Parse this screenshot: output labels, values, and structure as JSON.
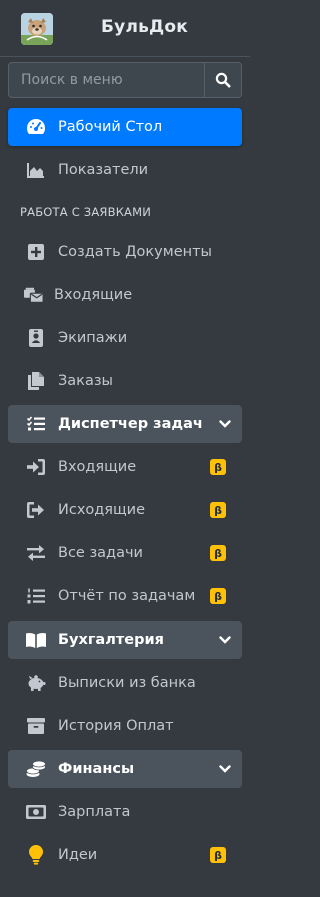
{
  "brand": {
    "title": "БульДок"
  },
  "search": {
    "placeholder": "Поиск в меню"
  },
  "colors": {
    "active": "#007bff",
    "badge": "#ffc107",
    "background": "#343a40",
    "open_group": "#4b545c"
  },
  "menu": {
    "dashboard": {
      "label": "Рабочий Стол",
      "icon": "tachometer-icon",
      "active": true
    },
    "indicators": {
      "label": "Показатели",
      "icon": "area-chart-icon"
    },
    "section_header": "РАБОТА С ЗАЯВКАМИ",
    "create_docs": {
      "label": "Создать Документы",
      "icon": "plus-square-icon"
    },
    "incoming": {
      "label": "Входящие",
      "icon": "mail-bulk-icon"
    },
    "crews": {
      "label": "Экипажи",
      "icon": "id-badge-icon"
    },
    "orders": {
      "label": "Заказы",
      "icon": "copy-icon"
    },
    "dispatcher": {
      "label": "Диспетчер задач",
      "icon": "tasks-icon",
      "expanded": true,
      "items": [
        {
          "label": "Входящие",
          "badge": "β",
          "icon": "sign-in-icon"
        },
        {
          "label": "Исходящие",
          "badge": "β",
          "icon": "sign-out-icon"
        },
        {
          "label": "Все задачи",
          "badge": "β",
          "icon": "exchange-icon"
        },
        {
          "label": "Отчёт по задачам",
          "badge": "β",
          "icon": "list-ol-icon"
        }
      ]
    },
    "accounting": {
      "label": "Бухгалтерия",
      "icon": "book-open-icon",
      "expanded": true,
      "items": [
        {
          "label": "Выписки из банка",
          "icon": "piggy-bank-icon"
        },
        {
          "label": "История Оплат",
          "icon": "archive-icon"
        }
      ]
    },
    "finance": {
      "label": "Финансы",
      "icon": "coins-icon",
      "expanded": true,
      "items": [
        {
          "label": "Зарплата",
          "icon": "money-bill-icon"
        },
        {
          "label": "Идеи",
          "badge": "β",
          "icon": "lightbulb-icon"
        }
      ]
    }
  }
}
